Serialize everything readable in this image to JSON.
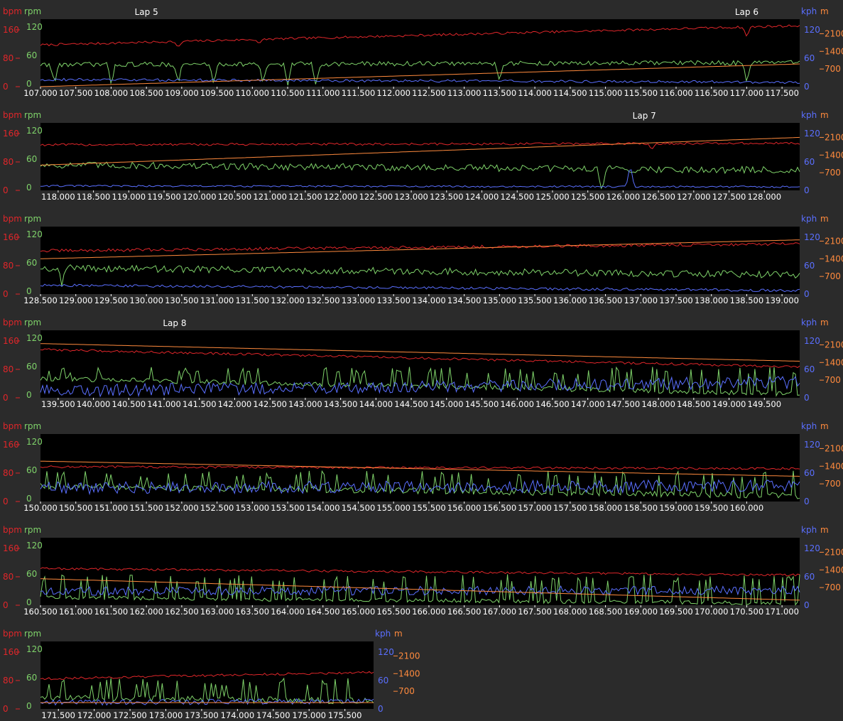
{
  "colors": {
    "background": "#2b2b2b",
    "plot_bg": "#000000",
    "bpm": "#e0262a",
    "rpm": "#7fd36a",
    "kph": "#5a6fff",
    "m": "#ff8a3d",
    "text": "#ffffff"
  },
  "labels": {
    "bpm": "bpm",
    "rpm": "rpm",
    "kph": "kph",
    "m": "m"
  },
  "chart_data": [
    {
      "type": "line",
      "x_range": [
        107.0,
        117.75
      ],
      "ticks": [
        "107.000",
        "107.500",
        "108.000",
        "108.500",
        "109.000",
        "109.500",
        "110.000",
        "110.500",
        "111.000",
        "111.500",
        "112.000",
        "112.500",
        "113.000",
        "113.500",
        "114.000",
        "114.500",
        "115.000",
        "115.500",
        "116.000",
        "116.500",
        "117.000",
        "117.500"
      ],
      "laps": [
        {
          "label": "Lap 5",
          "x": 108.5
        },
        {
          "label": "Lap 6",
          "x": 117.0
        }
      ],
      "series": [
        {
          "name": "bpm",
          "axis": "left",
          "shape": "flat",
          "start": 108,
          "end": 158,
          "noise": 3,
          "events": [
            {
              "x": 108.95,
              "depth": 18
            },
            {
              "x": 110.1,
              "depth": 12
            },
            {
              "x": 117.0,
              "depth": 25
            }
          ]
        },
        {
          "name": "rpm",
          "axis": "left",
          "shape": "flat",
          "start": 57,
          "end": 62,
          "noise": 6,
          "events": [
            {
              "x": 107.2,
              "depth": 50
            },
            {
              "x": 108.0,
              "depth": 50
            },
            {
              "x": 108.95,
              "depth": 50
            },
            {
              "x": 109.45,
              "depth": 50
            },
            {
              "x": 110.15,
              "depth": 55
            },
            {
              "x": 110.5,
              "depth": 55
            },
            {
              "x": 110.9,
              "depth": 55
            },
            {
              "x": 113.5,
              "depth": 40
            },
            {
              "x": 117.0,
              "depth": 45
            }
          ]
        },
        {
          "name": "kph",
          "axis": "right",
          "shape": "flat",
          "start": 16,
          "end": 10,
          "noise": 3,
          "events": []
        },
        {
          "name": "m",
          "axis": "right2",
          "shape": "line",
          "start": 0,
          "end": 900,
          "noise": 0,
          "events": []
        }
      ]
    },
    {
      "type": "line",
      "x_range": [
        117.75,
        128.5
      ],
      "ticks": [
        "118.000",
        "118.500",
        "119.000",
        "119.500",
        "120.000",
        "120.500",
        "121.000",
        "121.500",
        "122.000",
        "122.500",
        "123.000",
        "123.500",
        "124.000",
        "124.500",
        "125.000",
        "125.500",
        "126.000",
        "126.500",
        "127.000",
        "127.500",
        "128.000"
      ],
      "laps": [
        {
          "label": "Lap 7",
          "x": 126.3
        }
      ],
      "series": [
        {
          "name": "bpm",
          "axis": "left",
          "shape": "flat",
          "start": 118,
          "end": 122,
          "noise": 3,
          "events": [
            {
              "x": 126.4,
              "depth": 15
            }
          ]
        },
        {
          "name": "rpm",
          "axis": "left",
          "shape": "flat",
          "start": 66,
          "end": 52,
          "noise": 9,
          "events": [
            {
              "x": 125.7,
              "depth": 50
            }
          ]
        },
        {
          "name": "kph",
          "axis": "right",
          "shape": "flat",
          "start": 10,
          "end": 8,
          "noise": 2,
          "events": [
            {
              "x": 126.1,
              "depth": -50
            }
          ]
        },
        {
          "name": "m",
          "axis": "right2",
          "shape": "line",
          "start": 1000,
          "end": 2100,
          "noise": 0,
          "events": []
        }
      ]
    },
    {
      "type": "line",
      "x_range": [
        128.5,
        139.25
      ],
      "ticks": [
        "128.500",
        "129.000",
        "129.500",
        "130.000",
        "130.500",
        "131.000",
        "131.500",
        "132.000",
        "132.500",
        "133.000",
        "133.500",
        "134.000",
        "134.500",
        "135.000",
        "135.500",
        "136.000",
        "136.500",
        "137.000",
        "137.500",
        "138.000",
        "138.500",
        "139.000"
      ],
      "laps": [],
      "series": [
        {
          "name": "bpm",
          "axis": "left",
          "shape": "flat",
          "start": 112,
          "end": 130,
          "noise": 4,
          "events": []
        },
        {
          "name": "rpm",
          "axis": "left",
          "shape": "flat",
          "start": 68,
          "end": 50,
          "noise": 9,
          "events": [
            {
              "x": 128.8,
              "depth": 40
            }
          ]
        },
        {
          "name": "kph",
          "axis": "right",
          "shape": "flat",
          "start": 20,
          "end": 8,
          "noise": 3,
          "events": []
        },
        {
          "name": "m",
          "axis": "right2",
          "shape": "line",
          "start": 1400,
          "end": 2150,
          "noise": 0,
          "events": []
        }
      ]
    },
    {
      "type": "line",
      "x_range": [
        139.25,
        150.0
      ],
      "ticks": [
        "139.500",
        "140.000",
        "140.500",
        "141.000",
        "141.500",
        "142.000",
        "142.500",
        "143.000",
        "143.500",
        "144.000",
        "144.500",
        "145.000",
        "145.500",
        "146.000",
        "146.500",
        "147.000",
        "147.500",
        "148.000",
        "148.500",
        "149.000",
        "149.500"
      ],
      "laps": [
        {
          "label": "Lap 8",
          "x": 141.15
        }
      ],
      "series": [
        {
          "name": "bpm",
          "axis": "left",
          "shape": "flat",
          "start": 125,
          "end": 80,
          "noise": 3,
          "events": []
        },
        {
          "name": "rpm",
          "axis": "left",
          "shape": "spiky",
          "start": 50,
          "end": 10,
          "noise": 6,
          "events": []
        },
        {
          "name": "kph",
          "axis": "right",
          "shape": "noisy",
          "start": 10,
          "end": 30,
          "noise": 14,
          "events": []
        },
        {
          "name": "m",
          "axis": "right2",
          "shape": "line",
          "start": 2150,
          "end": 1450,
          "noise": 0,
          "events": []
        }
      ]
    },
    {
      "type": "line",
      "x_range": [
        150.0,
        160.75
      ],
      "ticks": [
        "150.000",
        "150.500",
        "151.000",
        "151.500",
        "152.000",
        "152.500",
        "153.000",
        "153.500",
        "154.000",
        "154.500",
        "155.000",
        "155.500",
        "156.000",
        "156.500",
        "157.000",
        "157.500",
        "158.000",
        "158.500",
        "159.000",
        "159.500",
        "160.000"
      ],
      "laps": [],
      "series": [
        {
          "name": "bpm",
          "axis": "left",
          "shape": "flat",
          "start": 90,
          "end": 85,
          "noise": 3,
          "events": []
        },
        {
          "name": "rpm",
          "axis": "left",
          "shape": "spiky",
          "start": 40,
          "end": 15,
          "noise": 8,
          "events": []
        },
        {
          "name": "kph",
          "axis": "right",
          "shape": "noisy",
          "start": 25,
          "end": 30,
          "noise": 14,
          "events": []
        },
        {
          "name": "m",
          "axis": "right2",
          "shape": "line",
          "start": 1600,
          "end": 1000,
          "noise": 0,
          "events": []
        }
      ]
    },
    {
      "type": "line",
      "x_range": [
        160.5,
        171.25
      ],
      "ticks": [
        "160.500",
        "161.000",
        "161.500",
        "162.000",
        "162.500",
        "163.000",
        "163.500",
        "164.000",
        "164.500",
        "165.000",
        "165.500",
        "166.000",
        "166.500",
        "167.000",
        "167.500",
        "168.000",
        "168.500",
        "169.000",
        "169.500",
        "170.000",
        "170.500",
        "171.000"
      ],
      "laps": [],
      "series": [
        {
          "name": "bpm",
          "axis": "left",
          "shape": "flat",
          "start": 95,
          "end": 78,
          "noise": 3,
          "events": []
        },
        {
          "name": "rpm",
          "axis": "left",
          "shape": "spiky",
          "start": 20,
          "end": 5,
          "noise": 5,
          "events": []
        },
        {
          "name": "kph",
          "axis": "right",
          "shape": "noisy",
          "start": 28,
          "end": 30,
          "noise": 10,
          "events": []
        },
        {
          "name": "m",
          "axis": "right2",
          "shape": "line",
          "start": 1050,
          "end": 200,
          "noise": 0,
          "events": []
        }
      ]
    },
    {
      "type": "line",
      "x_range": [
        171.25,
        175.9
      ],
      "ticks": [
        "171.500",
        "172.000",
        "172.500",
        "173.000",
        "173.500",
        "174.000",
        "174.500",
        "175.000",
        "175.500"
      ],
      "laps": [],
      "series": [
        {
          "name": "bpm",
          "axis": "left",
          "shape": "flat",
          "start": 78,
          "end": 95,
          "noise": 3,
          "events": []
        },
        {
          "name": "rpm",
          "axis": "left",
          "shape": "spiky",
          "start": 30,
          "end": 20,
          "noise": 8,
          "events": []
        },
        {
          "name": "kph",
          "axis": "right",
          "shape": "noisy",
          "start": 12,
          "end": 15,
          "noise": 6,
          "events": []
        },
        {
          "name": "m",
          "axis": "right2",
          "shape": "line",
          "start": 250,
          "end": 250,
          "noise": 0,
          "events": []
        }
      ]
    }
  ],
  "axes": {
    "left_bpm": [
      0,
      80,
      160
    ],
    "left_rpm": [
      0,
      60,
      120
    ],
    "right_kph": [
      0,
      60,
      120
    ],
    "right_m": [
      700,
      1400,
      2100
    ],
    "left_range": [
      0,
      160
    ],
    "right_range": [
      0,
      140
    ],
    "m_range": [
      0,
      2450
    ]
  }
}
